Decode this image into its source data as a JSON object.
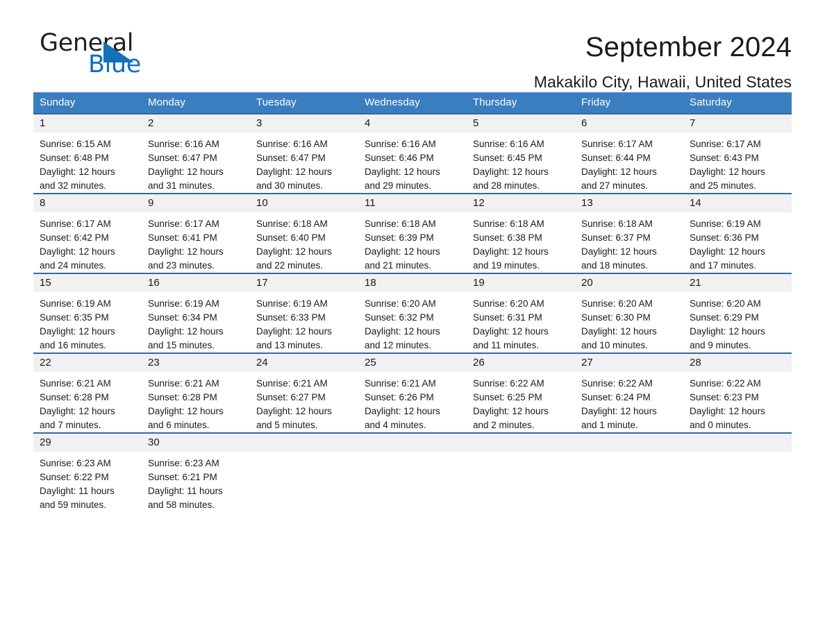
{
  "brand": {
    "name_part1": "General",
    "name_part2": "Blue",
    "accent_color": "#1271b8"
  },
  "header": {
    "month_title": "September 2024",
    "location": "Makakilo City, Hawaii, United States"
  },
  "calendar": {
    "weekday_headers": [
      "Sunday",
      "Monday",
      "Tuesday",
      "Wednesday",
      "Thursday",
      "Friday",
      "Saturday"
    ],
    "header_bg": "#3a7ebf",
    "daynum_bg": "#f1f1f1",
    "weeks": [
      {
        "days": [
          {
            "num": "1",
            "sunrise": "Sunrise: 6:15 AM",
            "sunset": "Sunset: 6:48 PM",
            "daylight_line1": "Daylight: 12 hours",
            "daylight_line2": "and 32 minutes."
          },
          {
            "num": "2",
            "sunrise": "Sunrise: 6:16 AM",
            "sunset": "Sunset: 6:47 PM",
            "daylight_line1": "Daylight: 12 hours",
            "daylight_line2": "and 31 minutes."
          },
          {
            "num": "3",
            "sunrise": "Sunrise: 6:16 AM",
            "sunset": "Sunset: 6:47 PM",
            "daylight_line1": "Daylight: 12 hours",
            "daylight_line2": "and 30 minutes."
          },
          {
            "num": "4",
            "sunrise": "Sunrise: 6:16 AM",
            "sunset": "Sunset: 6:46 PM",
            "daylight_line1": "Daylight: 12 hours",
            "daylight_line2": "and 29 minutes."
          },
          {
            "num": "5",
            "sunrise": "Sunrise: 6:16 AM",
            "sunset": "Sunset: 6:45 PM",
            "daylight_line1": "Daylight: 12 hours",
            "daylight_line2": "and 28 minutes."
          },
          {
            "num": "6",
            "sunrise": "Sunrise: 6:17 AM",
            "sunset": "Sunset: 6:44 PM",
            "daylight_line1": "Daylight: 12 hours",
            "daylight_line2": "and 27 minutes."
          },
          {
            "num": "7",
            "sunrise": "Sunrise: 6:17 AM",
            "sunset": "Sunset: 6:43 PM",
            "daylight_line1": "Daylight: 12 hours",
            "daylight_line2": "and 25 minutes."
          }
        ]
      },
      {
        "days": [
          {
            "num": "8",
            "sunrise": "Sunrise: 6:17 AM",
            "sunset": "Sunset: 6:42 PM",
            "daylight_line1": "Daylight: 12 hours",
            "daylight_line2": "and 24 minutes."
          },
          {
            "num": "9",
            "sunrise": "Sunrise: 6:17 AM",
            "sunset": "Sunset: 6:41 PM",
            "daylight_line1": "Daylight: 12 hours",
            "daylight_line2": "and 23 minutes."
          },
          {
            "num": "10",
            "sunrise": "Sunrise: 6:18 AM",
            "sunset": "Sunset: 6:40 PM",
            "daylight_line1": "Daylight: 12 hours",
            "daylight_line2": "and 22 minutes."
          },
          {
            "num": "11",
            "sunrise": "Sunrise: 6:18 AM",
            "sunset": "Sunset: 6:39 PM",
            "daylight_line1": "Daylight: 12 hours",
            "daylight_line2": "and 21 minutes."
          },
          {
            "num": "12",
            "sunrise": "Sunrise: 6:18 AM",
            "sunset": "Sunset: 6:38 PM",
            "daylight_line1": "Daylight: 12 hours",
            "daylight_line2": "and 19 minutes."
          },
          {
            "num": "13",
            "sunrise": "Sunrise: 6:18 AM",
            "sunset": "Sunset: 6:37 PM",
            "daylight_line1": "Daylight: 12 hours",
            "daylight_line2": "and 18 minutes."
          },
          {
            "num": "14",
            "sunrise": "Sunrise: 6:19 AM",
            "sunset": "Sunset: 6:36 PM",
            "daylight_line1": "Daylight: 12 hours",
            "daylight_line2": "and 17 minutes."
          }
        ]
      },
      {
        "days": [
          {
            "num": "15",
            "sunrise": "Sunrise: 6:19 AM",
            "sunset": "Sunset: 6:35 PM",
            "daylight_line1": "Daylight: 12 hours",
            "daylight_line2": "and 16 minutes."
          },
          {
            "num": "16",
            "sunrise": "Sunrise: 6:19 AM",
            "sunset": "Sunset: 6:34 PM",
            "daylight_line1": "Daylight: 12 hours",
            "daylight_line2": "and 15 minutes."
          },
          {
            "num": "17",
            "sunrise": "Sunrise: 6:19 AM",
            "sunset": "Sunset: 6:33 PM",
            "daylight_line1": "Daylight: 12 hours",
            "daylight_line2": "and 13 minutes."
          },
          {
            "num": "18",
            "sunrise": "Sunrise: 6:20 AM",
            "sunset": "Sunset: 6:32 PM",
            "daylight_line1": "Daylight: 12 hours",
            "daylight_line2": "and 12 minutes."
          },
          {
            "num": "19",
            "sunrise": "Sunrise: 6:20 AM",
            "sunset": "Sunset: 6:31 PM",
            "daylight_line1": "Daylight: 12 hours",
            "daylight_line2": "and 11 minutes."
          },
          {
            "num": "20",
            "sunrise": "Sunrise: 6:20 AM",
            "sunset": "Sunset: 6:30 PM",
            "daylight_line1": "Daylight: 12 hours",
            "daylight_line2": "and 10 minutes."
          },
          {
            "num": "21",
            "sunrise": "Sunrise: 6:20 AM",
            "sunset": "Sunset: 6:29 PM",
            "daylight_line1": "Daylight: 12 hours",
            "daylight_line2": "and 9 minutes."
          }
        ]
      },
      {
        "days": [
          {
            "num": "22",
            "sunrise": "Sunrise: 6:21 AM",
            "sunset": "Sunset: 6:28 PM",
            "daylight_line1": "Daylight: 12 hours",
            "daylight_line2": "and 7 minutes."
          },
          {
            "num": "23",
            "sunrise": "Sunrise: 6:21 AM",
            "sunset": "Sunset: 6:28 PM",
            "daylight_line1": "Daylight: 12 hours",
            "daylight_line2": "and 6 minutes."
          },
          {
            "num": "24",
            "sunrise": "Sunrise: 6:21 AM",
            "sunset": "Sunset: 6:27 PM",
            "daylight_line1": "Daylight: 12 hours",
            "daylight_line2": "and 5 minutes."
          },
          {
            "num": "25",
            "sunrise": "Sunrise: 6:21 AM",
            "sunset": "Sunset: 6:26 PM",
            "daylight_line1": "Daylight: 12 hours",
            "daylight_line2": "and 4 minutes."
          },
          {
            "num": "26",
            "sunrise": "Sunrise: 6:22 AM",
            "sunset": "Sunset: 6:25 PM",
            "daylight_line1": "Daylight: 12 hours",
            "daylight_line2": "and 2 minutes."
          },
          {
            "num": "27",
            "sunrise": "Sunrise: 6:22 AM",
            "sunset": "Sunset: 6:24 PM",
            "daylight_line1": "Daylight: 12 hours",
            "daylight_line2": "and 1 minute."
          },
          {
            "num": "28",
            "sunrise": "Sunrise: 6:22 AM",
            "sunset": "Sunset: 6:23 PM",
            "daylight_line1": "Daylight: 12 hours",
            "daylight_line2": "and 0 minutes."
          }
        ]
      },
      {
        "days": [
          {
            "num": "29",
            "sunrise": "Sunrise: 6:23 AM",
            "sunset": "Sunset: 6:22 PM",
            "daylight_line1": "Daylight: 11 hours",
            "daylight_line2": "and 59 minutes."
          },
          {
            "num": "30",
            "sunrise": "Sunrise: 6:23 AM",
            "sunset": "Sunset: 6:21 PM",
            "daylight_line1": "Daylight: 11 hours",
            "daylight_line2": "and 58 minutes."
          },
          {
            "num": "",
            "sunrise": "",
            "sunset": "",
            "daylight_line1": "",
            "daylight_line2": ""
          },
          {
            "num": "",
            "sunrise": "",
            "sunset": "",
            "daylight_line1": "",
            "daylight_line2": ""
          },
          {
            "num": "",
            "sunrise": "",
            "sunset": "",
            "daylight_line1": "",
            "daylight_line2": ""
          },
          {
            "num": "",
            "sunrise": "",
            "sunset": "",
            "daylight_line1": "",
            "daylight_line2": ""
          },
          {
            "num": "",
            "sunrise": "",
            "sunset": "",
            "daylight_line1": "",
            "daylight_line2": ""
          }
        ]
      }
    ]
  }
}
